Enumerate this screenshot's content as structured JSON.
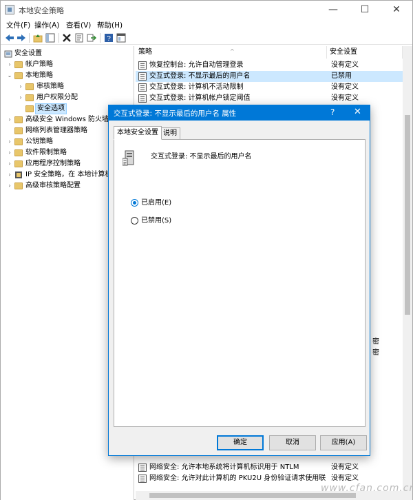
{
  "window": {
    "title": "本地安全策略",
    "controls": {
      "minimize": "—",
      "maximize": "☐",
      "close": "✕"
    }
  },
  "menu": [
    "文件(F)",
    "操作(A)",
    "查看(V)",
    "帮助(H)"
  ],
  "toolbar_icons": [
    "back-icon",
    "forward-icon",
    "up-folder-icon",
    "show-hide-tree-icon",
    "delete-icon",
    "properties-icon",
    "export-icon",
    "help-icon",
    "console-icon"
  ],
  "tree": {
    "root": "安全设置",
    "items": [
      {
        "label": "帐户策略",
        "level": 1,
        "expander": "›"
      },
      {
        "label": "本地策略",
        "level": 1,
        "expander": "⌄"
      },
      {
        "label": "审核策略",
        "level": 2,
        "expander": "›"
      },
      {
        "label": "用户权限分配",
        "level": 2,
        "expander": "›"
      },
      {
        "label": "安全选项",
        "level": 2,
        "expander": "",
        "selected": true
      },
      {
        "label": "高级安全 Windows 防火墙",
        "level": 1,
        "expander": "›"
      },
      {
        "label": "网络列表管理器策略",
        "level": 1,
        "expander": ""
      },
      {
        "label": "公钥策略",
        "level": 1,
        "expander": "›"
      },
      {
        "label": "软件限制策略",
        "level": 1,
        "expander": "›"
      },
      {
        "label": "应用程序控制策略",
        "level": 1,
        "expander": "›"
      },
      {
        "label": "IP 安全策略，在 本地计算机",
        "level": 1,
        "expander": "›"
      },
      {
        "label": "高级审核策略配置",
        "level": 1,
        "expander": "›"
      }
    ]
  },
  "list": {
    "columns": [
      "策略",
      "安全设置"
    ],
    "rows_top": [
      {
        "policy": "恢复控制台: 允许自动管理登录",
        "value": "没有定义"
      },
      {
        "policy": "交互式登录: 不显示最后的用户名",
        "value": "已禁用",
        "selected": true
      },
      {
        "policy": "交互式登录: 计算机不活动限制",
        "value": "没有定义"
      },
      {
        "policy": "交互式登录: 计算机帐户锁定阈值",
        "value": "没有定义"
      }
    ],
    "partial_right": [
      "密",
      "密"
    ],
    "rows_bottom": [
      {
        "policy": "网络安全: 允许本地系统将计算机标识用于 NTLM",
        "value": "没有定义"
      },
      {
        "policy": "网络安全: 允许对此计算机的 PKU2U 身份验证请求使用联",
        "value": "没有定义"
      }
    ]
  },
  "dialog": {
    "title": "交互式登录: 不显示最后的用户名 属性",
    "help": "?",
    "close": "✕",
    "tabs": [
      "本地安全设置",
      "说明"
    ],
    "heading": "交互式登录: 不显示最后的用户名",
    "options": [
      {
        "label": "已启用(E)",
        "checked": true
      },
      {
        "label": "已禁用(S)",
        "checked": false
      }
    ],
    "buttons": {
      "ok": "确定",
      "cancel": "取消",
      "apply": "应用(A)"
    }
  },
  "watermark": "www.cfan.com.cn",
  "colors": {
    "accent": "#0078d7",
    "selection": "#cce8ff",
    "folder": "#e8c66a"
  }
}
